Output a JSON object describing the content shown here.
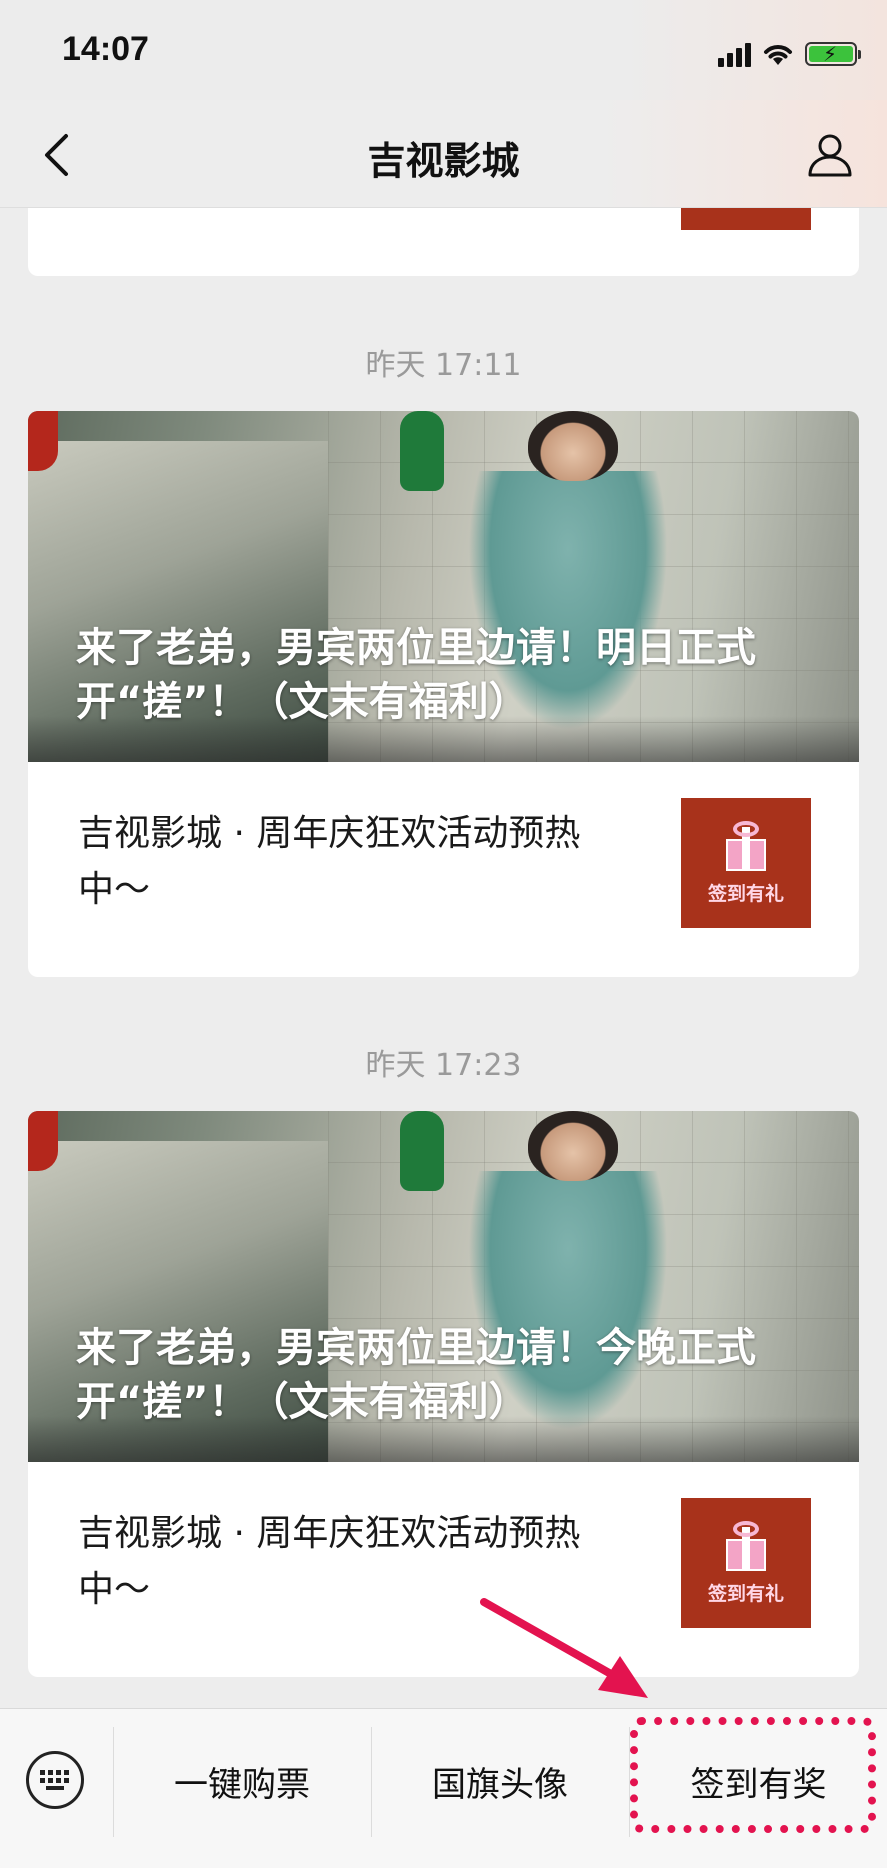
{
  "status_bar": {
    "time": "14:07",
    "icons": [
      "signal-icon",
      "wifi-icon",
      "battery-charging-icon"
    ]
  },
  "nav": {
    "back_icon": "chevron-left-icon",
    "title": "吉视影城",
    "profile_icon": "person-icon"
  },
  "feed": {
    "messages": [
      {
        "timestamp": "昨天 17:11",
        "headline": "来了老弟，男宾两位里边请！明日正式开“搓”！（文末有福利）",
        "subtitle": "吉视影城 · 周年庆狂欢活动预热中～",
        "thumb_label": "签到有礼"
      },
      {
        "timestamp": "昨天 17:23",
        "headline": "来了老弟，男宾两位里边请！今晚正式开“搓”！（文末有福利）",
        "subtitle": "吉视影城 · 周年庆狂欢活动预热中～",
        "thumb_label": "签到有礼"
      }
    ]
  },
  "menu": {
    "keyboard_icon": "keyboard-icon",
    "items": [
      {
        "label": "一键购票"
      },
      {
        "label": "国旗头像"
      },
      {
        "label": "签到有奖"
      }
    ]
  },
  "annotations": {
    "highlight_color": "#e3134f"
  }
}
